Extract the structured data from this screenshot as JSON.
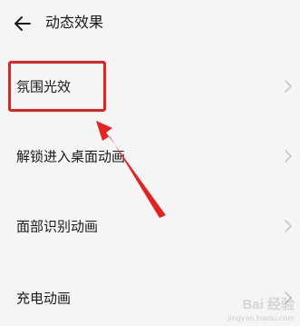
{
  "header": {
    "title": "动态效果"
  },
  "items": [
    {
      "label": "氛围光效"
    },
    {
      "label": "解锁进入桌面动画"
    },
    {
      "label": "面部识别动画"
    },
    {
      "label": "充电动画"
    }
  ],
  "watermark": {
    "text": "Bai 经验",
    "sub": "jingyan.baidu.com"
  },
  "colors": {
    "annotation": "#e52222",
    "background": "#f5f5f5",
    "chevron": "#c8c8c8"
  }
}
